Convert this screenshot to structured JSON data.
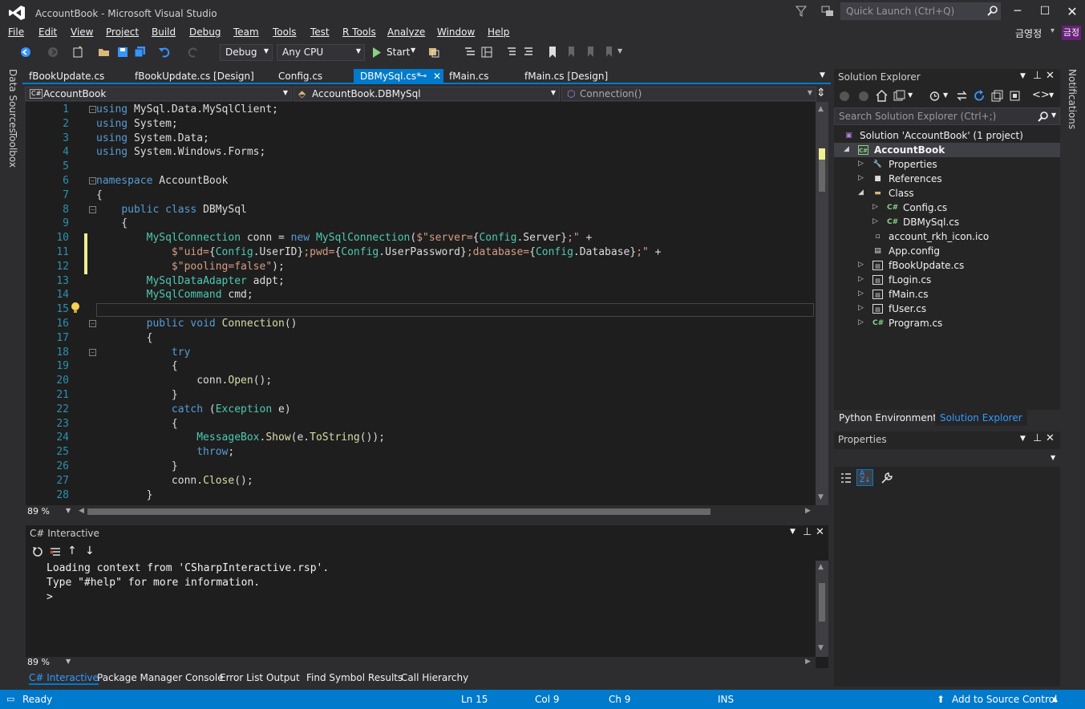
{
  "window": {
    "title": "AccountBook - Microsoft Visual Studio",
    "quick_launch_placeholder": "Quick Launch (Ctrl+Q)",
    "user": "금영정",
    "user_badge": "금정"
  },
  "menu": [
    "File",
    "Edit",
    "View",
    "Project",
    "Build",
    "Debug",
    "Team",
    "Tools",
    "Test",
    "R Tools",
    "Analyze",
    "Window",
    "Help"
  ],
  "toolbar": {
    "config": "Debug",
    "platform": "Any CPU",
    "start_label": "Start"
  },
  "side_tabs": {
    "left": [
      "Data Sources",
      "Toolbox"
    ],
    "right": [
      "Notifications"
    ]
  },
  "doc_tabs": [
    {
      "label": "fBookUpdate.cs",
      "active": false
    },
    {
      "label": "fBookUpdate.cs [Design]",
      "active": false
    },
    {
      "label": "Config.cs",
      "active": false
    },
    {
      "label": "DBMySql.cs*",
      "active": true
    },
    {
      "label": "fMain.cs",
      "active": false
    },
    {
      "label": "fMain.cs [Design]",
      "active": false
    }
  ],
  "nav": {
    "project": "AccountBook",
    "type": "AccountBook.DBMySql",
    "member": "Connection()"
  },
  "editor": {
    "zoom": "89 %",
    "current_line": 15
  },
  "code": [
    {
      "n": "1",
      "text": "using MySql.Data.MySqlClient;"
    },
    {
      "n": "2",
      "text": "using System;"
    },
    {
      "n": "3",
      "text": "using System.Data;"
    },
    {
      "n": "4",
      "text": "using System.Windows.Forms;"
    },
    {
      "n": "5",
      "text": ""
    },
    {
      "n": "6",
      "text": "namespace AccountBook"
    },
    {
      "n": "7",
      "text": "{"
    },
    {
      "n": "8",
      "text": "    public class DBMySql"
    },
    {
      "n": "9",
      "text": "    {"
    },
    {
      "n": "10",
      "text": "        MySqlConnection conn = new MySqlConnection($\"server={Config.Server};\" +"
    },
    {
      "n": "11",
      "text": "            $\"uid={Config.UserID};pwd={Config.UserPassword};database={Config.Database};\" +"
    },
    {
      "n": "12",
      "text": "            $\"pooling=false\");"
    },
    {
      "n": "13",
      "text": "        MySqlDataAdapter adpt;"
    },
    {
      "n": "14",
      "text": "        MySqlCommand cmd;"
    },
    {
      "n": "15",
      "text": "        "
    },
    {
      "n": "16",
      "text": "        public void Connection()"
    },
    {
      "n": "17",
      "text": "        {"
    },
    {
      "n": "18",
      "text": "            try"
    },
    {
      "n": "19",
      "text": "            {"
    },
    {
      "n": "20",
      "text": "                conn.Open();"
    },
    {
      "n": "21",
      "text": "            }"
    },
    {
      "n": "22",
      "text": "            catch (Exception e)"
    },
    {
      "n": "23",
      "text": "            {"
    },
    {
      "n": "24",
      "text": "                MessageBox.Show(e.ToString());"
    },
    {
      "n": "25",
      "text": "                throw;"
    },
    {
      "n": "26",
      "text": "            }"
    },
    {
      "n": "27",
      "text": "            conn.Close();"
    },
    {
      "n": "28",
      "text": "        }"
    }
  ],
  "interactive": {
    "title": "C# Interactive",
    "lines": [
      "Loading context from 'CSharpInteractive.rsp'.",
      "Type \"#help\" for more information.",
      "> "
    ],
    "zoom": "89 %"
  },
  "bottom_tabs": [
    "C# Interactive",
    "Package Manager Console",
    "Error List",
    "Output",
    "Find Symbol Results",
    "Call Hierarchy"
  ],
  "solution_explorer": {
    "title": "Solution Explorer",
    "search_placeholder": "Search Solution Explorer (Ctrl+;)",
    "items": [
      {
        "label": "Solution 'AccountBook' (1 project)",
        "icon": "solution-icon",
        "level": 0,
        "arrow": ""
      },
      {
        "label": "AccountBook",
        "icon": "csproj-icon",
        "level": 0,
        "arrow": "open",
        "bold": true
      },
      {
        "label": "Properties",
        "icon": "wrench-icon",
        "level": 1,
        "arrow": "closed"
      },
      {
        "label": "References",
        "icon": "references-icon",
        "level": 1,
        "arrow": "closed"
      },
      {
        "label": "Class",
        "icon": "folder-icon",
        "level": 1,
        "arrow": "open"
      },
      {
        "label": "Config.cs",
        "icon": "csharp-file-icon",
        "level": 2,
        "arrow": "closed"
      },
      {
        "label": "DBMySql.cs",
        "icon": "csharp-file-icon",
        "level": 2,
        "arrow": "closed"
      },
      {
        "label": "account_rkh_icon.ico",
        "icon": "ico-file-icon",
        "level": 1,
        "arrow": ""
      },
      {
        "label": "App.config",
        "icon": "config-file-icon",
        "level": 1,
        "arrow": ""
      },
      {
        "label": "fBookUpdate.cs",
        "icon": "form-icon",
        "level": 1,
        "arrow": "closed"
      },
      {
        "label": "fLogin.cs",
        "icon": "form-icon",
        "level": 1,
        "arrow": "closed"
      },
      {
        "label": "fMain.cs",
        "icon": "form-icon",
        "level": 1,
        "arrow": "closed"
      },
      {
        "label": "fUser.cs",
        "icon": "form-icon",
        "level": 1,
        "arrow": "closed"
      },
      {
        "label": "Program.cs",
        "icon": "csharp-file-icon",
        "level": 1,
        "arrow": "closed"
      }
    ]
  },
  "panel_tabs": [
    {
      "label": "Python Environments",
      "active": false
    },
    {
      "label": "Solution Explorer",
      "active": true
    }
  ],
  "properties": {
    "title": "Properties"
  },
  "status": {
    "state": "Ready",
    "ln": "Ln 15",
    "col": "Col 9",
    "ch": "Ch 9",
    "mode": "INS",
    "source_control": "Add to Source Control"
  },
  "colors": {
    "accent": "#007acc",
    "keyword": "#569cd6",
    "type": "#4ec9b0",
    "string": "#d69d85",
    "line_number": "#2b91af"
  }
}
